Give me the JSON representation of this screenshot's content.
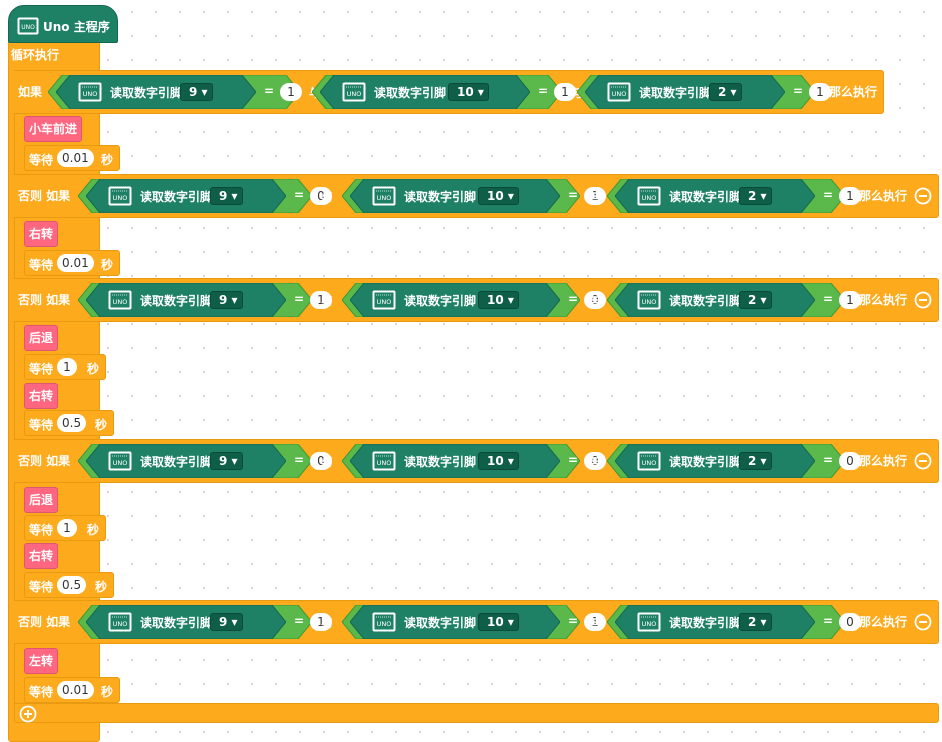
{
  "hat": {
    "chip": "UNO",
    "title": "Uno 主程序"
  },
  "loop_label": "循环执行",
  "common": {
    "read_pin": "读取数字引脚",
    "and": "与",
    "then": "那么执行",
    "eq": "=",
    "seconds": "秒",
    "wait": "等待"
  },
  "branches": [
    {
      "prefix": "如果",
      "conds": [
        {
          "pin": "9",
          "val": "1"
        },
        {
          "pin": "10",
          "val": "1"
        },
        {
          "pin": "2",
          "val": "1"
        }
      ],
      "body": [
        {
          "type": "action",
          "label": "小车前进"
        },
        {
          "type": "wait",
          "value": "0.01"
        }
      ]
    },
    {
      "prefix": "否则 如果",
      "conds": [
        {
          "pin": "9",
          "val": "0"
        },
        {
          "pin": "10",
          "val": "1"
        },
        {
          "pin": "2",
          "val": "1"
        }
      ],
      "body": [
        {
          "type": "action",
          "label": "右转"
        },
        {
          "type": "wait",
          "value": "0.01"
        }
      ]
    },
    {
      "prefix": "否则 如果",
      "conds": [
        {
          "pin": "9",
          "val": "1"
        },
        {
          "pin": "10",
          "val": "0"
        },
        {
          "pin": "2",
          "val": "1"
        }
      ],
      "body": [
        {
          "type": "action",
          "label": "后退"
        },
        {
          "type": "wait",
          "value": "1"
        },
        {
          "type": "action",
          "label": "右转"
        },
        {
          "type": "wait",
          "value": "0.5"
        }
      ]
    },
    {
      "prefix": "否则 如果",
      "conds": [
        {
          "pin": "9",
          "val": "0"
        },
        {
          "pin": "10",
          "val": "0"
        },
        {
          "pin": "2",
          "val": "0"
        }
      ],
      "body": [
        {
          "type": "action",
          "label": "后退"
        },
        {
          "type": "wait",
          "value": "1"
        },
        {
          "type": "action",
          "label": "右转"
        },
        {
          "type": "wait",
          "value": "0.5"
        }
      ]
    },
    {
      "prefix": "否则 如果",
      "conds": [
        {
          "pin": "9",
          "val": "1"
        },
        {
          "pin": "10",
          "val": "1"
        },
        {
          "pin": "2",
          "val": "0"
        }
      ],
      "body": [
        {
          "type": "action",
          "label": "左转"
        },
        {
          "type": "wait",
          "value": "0.01"
        }
      ]
    }
  ],
  "colors": {
    "control": "#FDAA1C",
    "logic": "#5BB84A",
    "pin_block": "#1E8166",
    "action": "#FF6680"
  }
}
